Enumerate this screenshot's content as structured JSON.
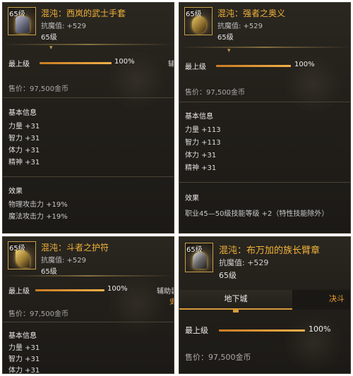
{
  "panels": [
    {
      "level_badge": "65级",
      "name": "混沌：西岚的武士手套",
      "stat": "抗魔值: +529",
      "level": "65级",
      "max_level_label": "最上级",
      "progress_pct_text": "100%",
      "progress": 1.0,
      "side_tag": "辅",
      "price": "售价：97,500金币",
      "basic_info_title": "基本信息",
      "attrs": [
        "力量 +31",
        "智力 +31",
        "体力 +31",
        "精神 +31"
      ],
      "effects_title": "效果",
      "effects": [
        "物理攻击力 +19%",
        "魔法攻击力 +19%"
      ],
      "icon": "gauntlet-icon"
    },
    {
      "level_badge": "65级",
      "name": "混沌：强者之奥义",
      "stat": "抗魔值: +529",
      "level": "65级",
      "max_level_label": "最上级",
      "progress_pct_text": "100%",
      "progress": 1.0,
      "price": "售价：97,500金币",
      "basic_info_title": "基本信息",
      "attrs": [
        "力量 +113",
        "智力 +113",
        "体力 +31",
        "精神 +31"
      ],
      "effects_title": "效果",
      "effects": [
        "职业45—50级技能等级 +2（特性技能除外）"
      ],
      "icon": "emblem-icon"
    },
    {
      "level_badge": "65级",
      "name": "混沌：斗者之护符",
      "stat": "抗魔值: +529",
      "level": "65级",
      "max_level_label": "最上级",
      "progress_pct_text": "100%",
      "progress": 1.0,
      "side_tag": "辅助装",
      "side_tag2": "史",
      "price": "售价：97,500金币",
      "basic_info_title": "基本信息",
      "attrs": [
        "力量 +31",
        "智力 +31",
        "体力 +31"
      ],
      "icon": "amulet-icon"
    },
    {
      "level_badge": "65级",
      "name": "混沌：布万加的族长臂章",
      "stat": "抗魔值: +529",
      "level": "65级",
      "tabs": [
        "地下城",
        "决斗"
      ],
      "tab_second_visible": "决斗",
      "max_level_label": "最上级",
      "progress_pct_text": "100%",
      "progress": 1.0,
      "price": "售价：97,500金币",
      "icon": "armband-icon"
    }
  ],
  "colors": {
    "name": "#f3b33a",
    "bar_fill": "#f2b049",
    "tab_underline": "#d69a3a",
    "panel_bg": "#221f1a"
  }
}
